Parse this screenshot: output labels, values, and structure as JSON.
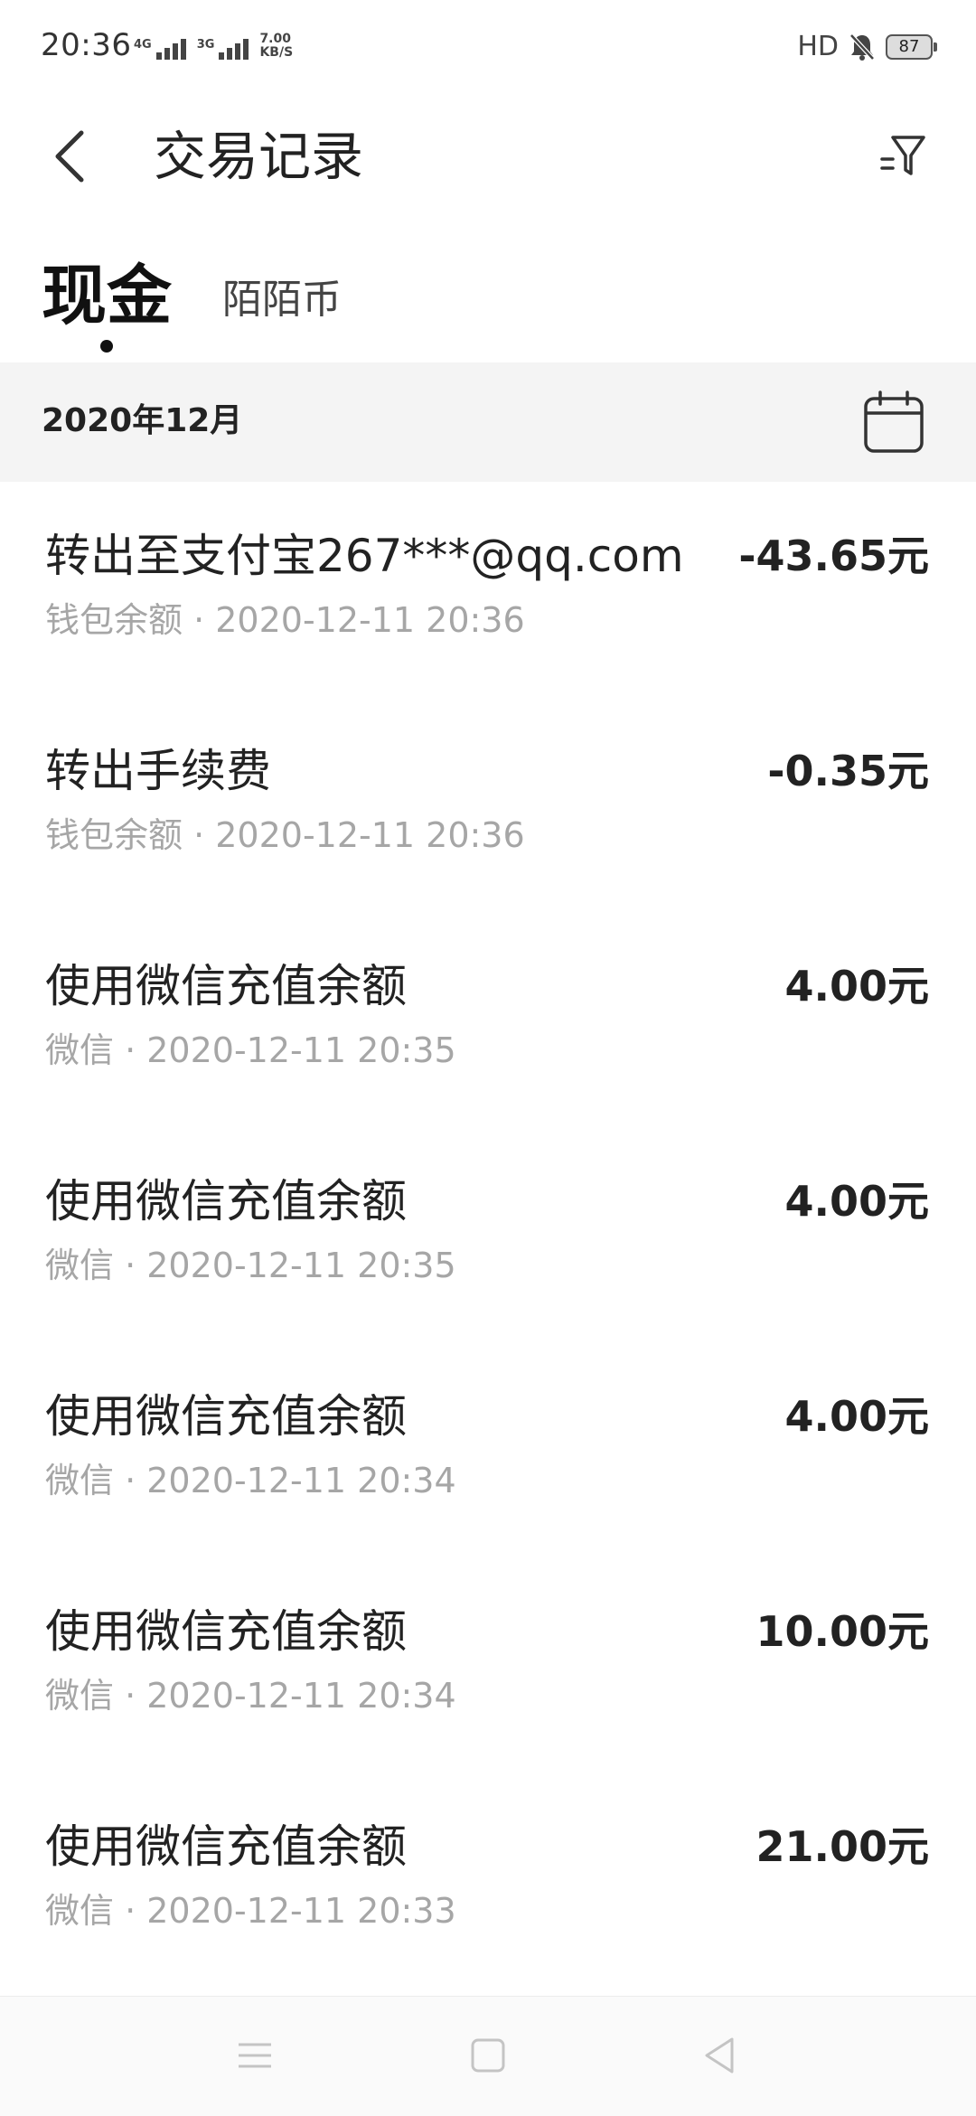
{
  "status_bar": {
    "time": "20:36",
    "signal_1_label": "4G",
    "signal_2_label": "3G",
    "speed_value": "7.00",
    "speed_unit": "KB/S",
    "hd_label": "HD",
    "battery": "87"
  },
  "header": {
    "title": "交易记录"
  },
  "tabs": {
    "cash": "现金",
    "momo_coin": "陌陌币"
  },
  "month": "2020年12月",
  "transactions": [
    {
      "title": "转出至支付宝267***@qq.com",
      "meta": "钱包余额 · 2020-12-11 20:36",
      "amount": "-43.65元"
    },
    {
      "title": "转出手续费",
      "meta": "钱包余额 · 2020-12-11 20:36",
      "amount": "-0.35元"
    },
    {
      "title": "使用微信充值余额",
      "meta": "微信 · 2020-12-11 20:35",
      "amount": "4.00元"
    },
    {
      "title": "使用微信充值余额",
      "meta": "微信 · 2020-12-11 20:35",
      "amount": "4.00元"
    },
    {
      "title": "使用微信充值余额",
      "meta": "微信 · 2020-12-11 20:34",
      "amount": "4.00元"
    },
    {
      "title": "使用微信充值余额",
      "meta": "微信 · 2020-12-11 20:34",
      "amount": "10.00元"
    },
    {
      "title": "使用微信充值余额",
      "meta": "微信 · 2020-12-11 20:33",
      "amount": "21.00元"
    }
  ],
  "icons": {
    "back": "chevron-left-icon",
    "filter": "filter-icon",
    "calendar": "calendar-icon",
    "mute": "bell-off-icon",
    "nav_menu": "menu-icon",
    "nav_home": "square-icon",
    "nav_back": "triangle-back-icon"
  },
  "colors": {
    "background": "#ffffff",
    "month_bar": "#f4f4f4",
    "primary_text": "#222222",
    "secondary_text": "#a6a6a6"
  }
}
